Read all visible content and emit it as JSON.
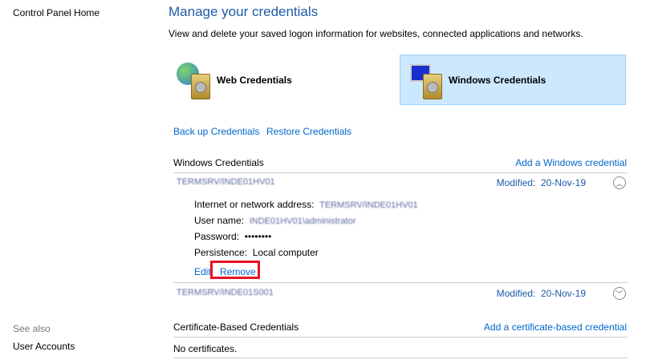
{
  "sidebar": {
    "home": "Control Panel Home",
    "see_also": "See also",
    "user_accounts": "User Accounts"
  },
  "header": {
    "title": "Manage your credentials",
    "description": "View and delete your saved logon information for websites, connected applications and networks."
  },
  "tiles": {
    "web": "Web Credentials",
    "windows": "Windows Credentials"
  },
  "actions": {
    "backup": "Back up Credentials",
    "restore": "Restore Credentials"
  },
  "windows_section": {
    "title": "Windows Credentials",
    "add": "Add a Windows credential",
    "items": [
      {
        "name": "TERMSRV/INDE01HV01",
        "modified_label": "Modified:",
        "modified": "20-Nov-19",
        "address_label": "Internet or network address:",
        "address": "TERMSRV/INDE01HV01",
        "user_label": "User name:",
        "user": "INDE01HV01\\administrator",
        "password_label": "Password:",
        "password": "••••••••",
        "persistence_label": "Persistence:",
        "persistence": "Local computer",
        "edit": "Edit",
        "remove": "Remove"
      },
      {
        "name": "TERMSRV/INDE01S001",
        "modified_label": "Modified:",
        "modified": "20-Nov-19"
      }
    ]
  },
  "cert_section": {
    "title": "Certificate-Based Credentials",
    "add": "Add a certificate-based credential",
    "empty": "No certificates."
  },
  "colors": {
    "highlight": "#e81123",
    "selected_tile": "#cce8ff"
  }
}
